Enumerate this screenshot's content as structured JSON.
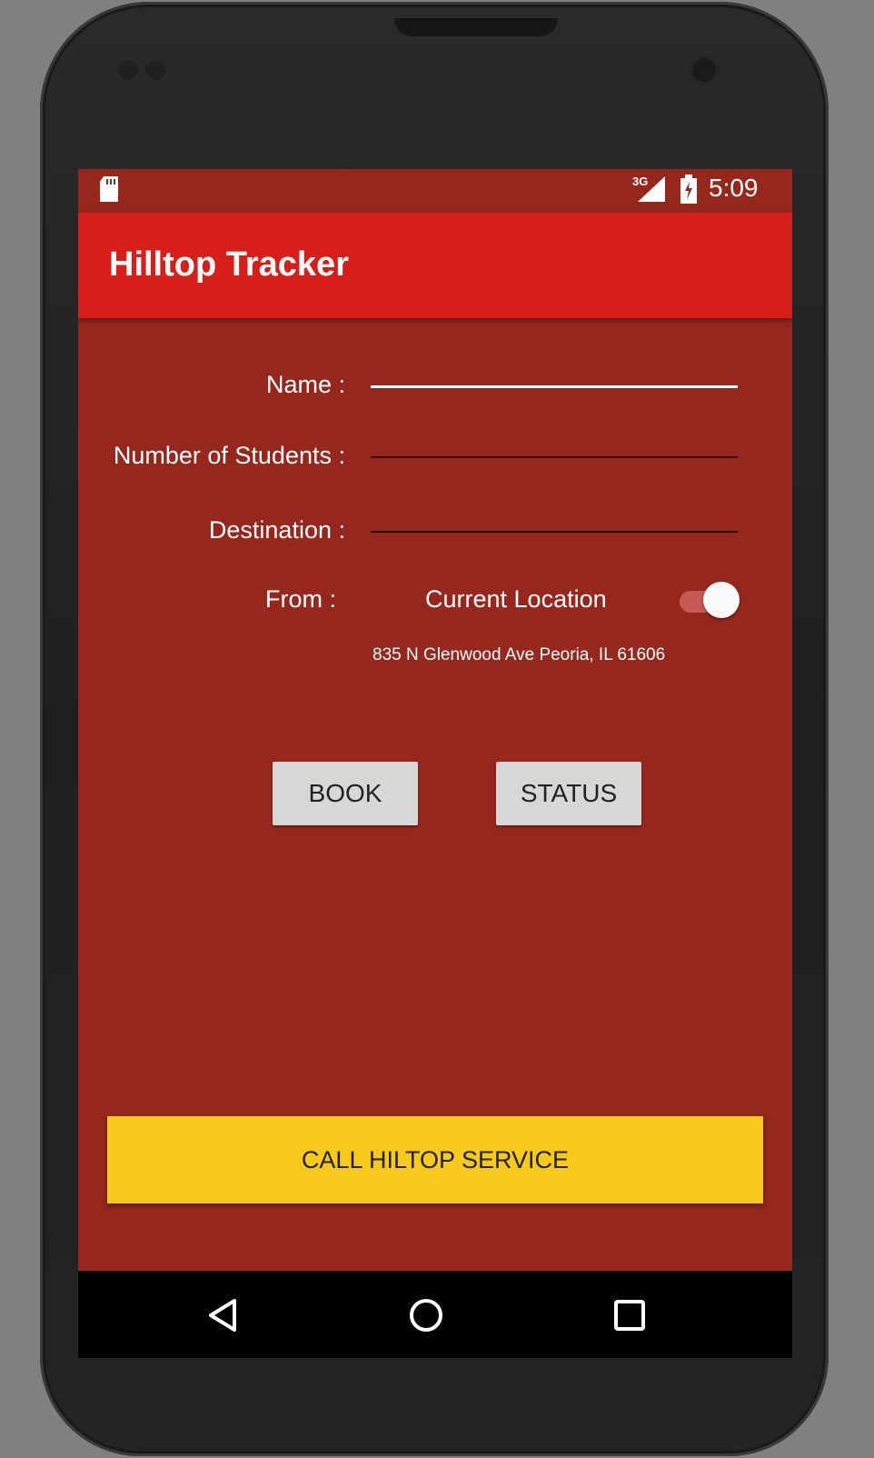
{
  "status_bar": {
    "time": "5:09",
    "network": "3G",
    "icons": [
      "sd-card-icon",
      "signal-icon",
      "battery-icon"
    ]
  },
  "app_bar": {
    "title": "Hilltop Tracker"
  },
  "form": {
    "name_label": "Name :",
    "name_value": "",
    "students_label": "Number of Students :",
    "students_value": "",
    "destination_label": "Destination :",
    "destination_value": "",
    "from_label": "From :",
    "current_location_label": "Current Location",
    "current_location_toggle": "on",
    "address": "835 N Glenwood Ave Peoria, IL 61606"
  },
  "buttons": {
    "book": "BOOK",
    "status": "STATUS",
    "call": "CALL HILTOP SERVICE"
  },
  "nav": {
    "icons": [
      "back-icon",
      "home-icon",
      "recents-icon"
    ]
  },
  "colors": {
    "background": "#96271d",
    "app_bar": "#d81e18",
    "call_button": "#f6c91a",
    "button": "#d6d7d7"
  }
}
